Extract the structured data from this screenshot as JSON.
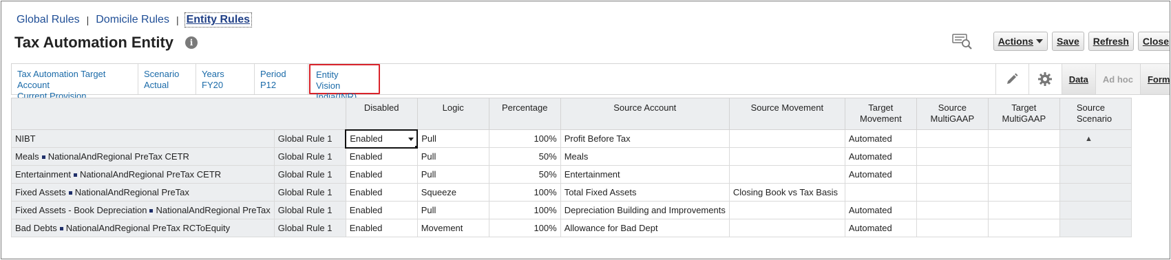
{
  "breadcrumb": {
    "items": [
      "Global Rules",
      "Domicile Rules",
      "Entity Rules"
    ],
    "separator": "|"
  },
  "page": {
    "title": "Tax Automation Entity"
  },
  "toolbar": {
    "actions_label": "Actions",
    "save_label": "Save",
    "refresh_label": "Refresh",
    "close_label": "Close"
  },
  "pov": [
    {
      "name": "Tax Automation Target Account",
      "value": "Current Provision"
    },
    {
      "name": "Scenario",
      "value": "Actual"
    },
    {
      "name": "Years",
      "value": "FY20"
    },
    {
      "name": "Period",
      "value": "P12"
    },
    {
      "name": "Entity",
      "value": "Vision India(INR)"
    }
  ],
  "side_tabs": {
    "data": "Data",
    "adhoc": "Ad hoc",
    "format": "Format"
  },
  "grid": {
    "columns": [
      "Disabled",
      "Logic",
      "Percentage",
      "Source Account",
      "Source Movement",
      "Target Movement",
      "Source MultiGAAP",
      "Target MultiGAAP",
      "Source Scenario"
    ],
    "rows": [
      {
        "account": "NIBT",
        "tags": "",
        "rule": "Global Rule 1",
        "disabled": "Enabled",
        "logic": "Pull",
        "percentage": "100%",
        "source_account": "Profit Before Tax",
        "source_movement": "",
        "target_movement": "Automated"
      },
      {
        "account": "Meals",
        "tags": "NationalAndRegional PreTax CETR",
        "rule": "Global Rule 1",
        "disabled": "Enabled",
        "logic": "Pull",
        "percentage": "50%",
        "source_account": "Meals",
        "source_movement": "",
        "target_movement": "Automated"
      },
      {
        "account": "Entertainment",
        "tags": "NationalAndRegional PreTax CETR",
        "rule": "Global Rule 1",
        "disabled": "Enabled",
        "logic": "Pull",
        "percentage": "50%",
        "source_account": "Entertainment",
        "source_movement": "",
        "target_movement": "Automated"
      },
      {
        "account": "Fixed Assets",
        "tags": "NationalAndRegional PreTax",
        "rule": "Global Rule 1",
        "disabled": "Enabled",
        "logic": "Squeeze",
        "percentage": "100%",
        "source_account": "Total Fixed Assets",
        "source_movement": "Closing Book vs Tax Basis",
        "target_movement": ""
      },
      {
        "account": "Fixed Assets - Book Depreciation",
        "tags": "NationalAndRegional PreTax",
        "rule": "Global Rule 1",
        "disabled": "Enabled",
        "logic": "Pull",
        "percentage": "100%",
        "source_account": "Depreciation Building and Improvements",
        "source_movement": "",
        "target_movement": "Automated"
      },
      {
        "account": "Bad Debts",
        "tags": "NationalAndRegional PreTax RCToEquity",
        "rule": "Global Rule 1",
        "disabled": "Enabled",
        "logic": "Movement",
        "percentage": "100%",
        "source_account": "Allowance for Bad Dept",
        "source_movement": "",
        "target_movement": "Automated"
      }
    ]
  },
  "colors": {
    "link": "#1f4e96",
    "pov_link": "#1a6aa8",
    "highlight_border": "#d9232a",
    "header_bg": "#eceef0"
  }
}
